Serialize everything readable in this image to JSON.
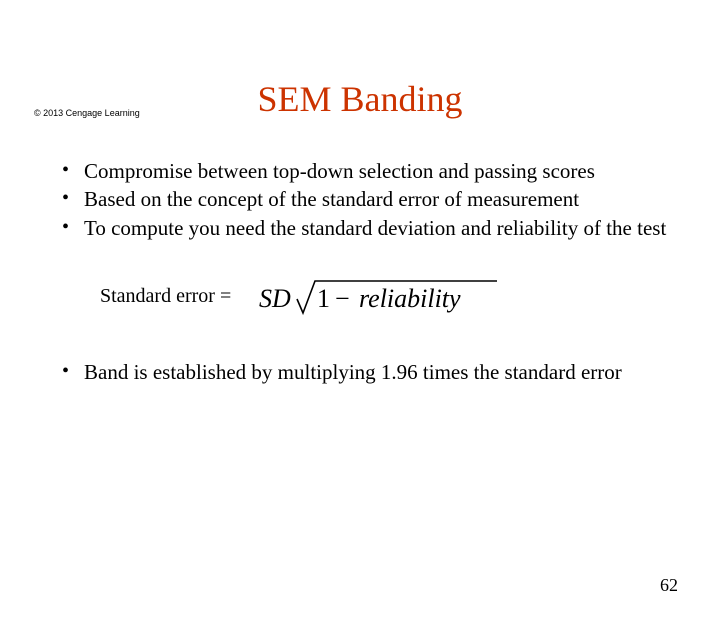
{
  "copyright": "© 2013 Cengage Learning",
  "title": "SEM Banding",
  "bullets_top": [
    "Compromise between top-down selection and passing scores",
    "Based on the concept of the standard error of measurement",
    "To compute you need the standard deviation and reliability of the test"
  ],
  "formula": {
    "label": "Standard error =",
    "sd": "SD",
    "one": "1",
    "minus": "−",
    "reliability": "reliability"
  },
  "bullets_bottom": [
    "Band is established by multiplying 1.96 times the standard error"
  ],
  "page_number": "62"
}
